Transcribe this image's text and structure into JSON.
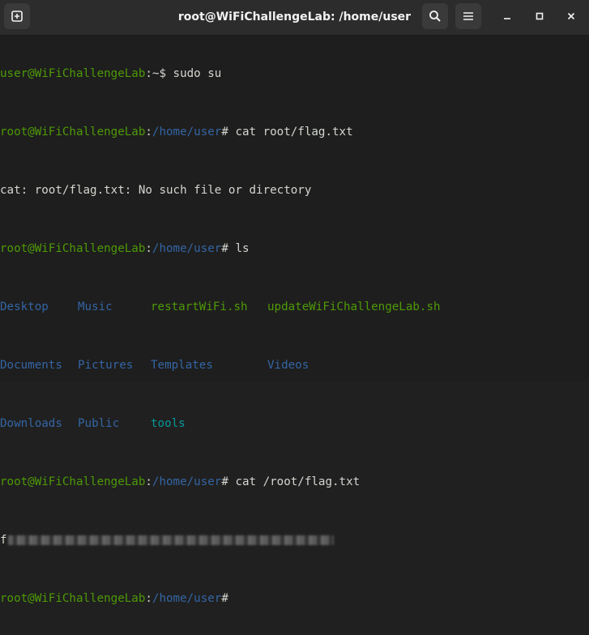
{
  "window": {
    "title": "root@WiFiChallengeLab: /home/user"
  },
  "toolbar": {
    "new_tab_icon": "new-tab-icon",
    "search_icon": "search-icon",
    "menu_icon": "hamburger-menu-icon",
    "minimize_icon": "minimize-icon",
    "maximize_icon": "maximize-icon",
    "close_icon": "close-icon"
  },
  "colors": {
    "prompt_green": "#4e9a06",
    "path_blue": "#3465a4",
    "text": "#d3d7cf",
    "teal": "#06989a",
    "background": "#1e1e1e"
  },
  "terminal": {
    "line1": {
      "user": "user@WiFiChallengeLab",
      "sep": ":~$ ",
      "cmd": "sudo su"
    },
    "line2": {
      "user": "root@WiFiChallengeLab",
      "sep": ":",
      "path": "/home/user",
      "hash": "# ",
      "cmd": "cat root/flag.txt"
    },
    "line3": {
      "text": "cat: root/flag.txt: No such file or directory"
    },
    "line4": {
      "user": "root@WiFiChallengeLab",
      "sep": ":",
      "path": "/home/user",
      "hash": "# ",
      "cmd": "ls"
    },
    "ls": {
      "row1": [
        "Desktop",
        "Music",
        "restartWiFi.sh",
        "updateWiFiChallengeLab.sh"
      ],
      "row2": [
        "Documents",
        "Pictures",
        "Templates",
        "Videos"
      ],
      "row3": [
        "Downloads",
        "Public",
        "tools"
      ]
    },
    "line8": {
      "user": "root@WiFiChallengeLab",
      "sep": ":",
      "path": "/home/user",
      "hash": "# ",
      "cmd": "cat /root/flag.txt"
    },
    "line9": {
      "prefix": "f"
    },
    "line10": {
      "user": "root@WiFiChallengeLab",
      "sep": ":",
      "path": "/home/user",
      "hash": "#"
    }
  }
}
